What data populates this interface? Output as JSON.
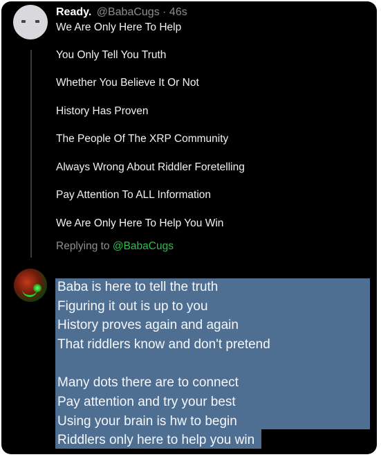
{
  "tweet": {
    "display_name": "Ready.",
    "handle": "@BabaCugs",
    "age": "46s",
    "lines": [
      "We Are Only Here To Help",
      "You Only Tell You Truth",
      "Whether You Believe It Or Not",
      "History Has Proven",
      "The People Of The XRP Community",
      "Always Wrong About Riddler Foretelling",
      "Pay Attention To ALL Information",
      "We Are Only Here To Help You Win"
    ],
    "replying_prefix": "Replying to",
    "replying_handle": "@BabaCugs"
  },
  "reply": {
    "lines": [
      "Baba is here to tell the truth",
      "Figuring it out is up to you",
      "History proves again and again",
      "That riddlers know and don't pretend",
      "",
      "Many dots there are to connect",
      "Pay attention and try your best",
      "Using your brain is hw to begin",
      "Riddlers  only here to help you win"
    ]
  },
  "colors": {
    "background": "#000000",
    "text": "#f2f2f2",
    "muted": "#8b8f94",
    "link": "#2ebd4f",
    "selection": "#4f6f92"
  }
}
